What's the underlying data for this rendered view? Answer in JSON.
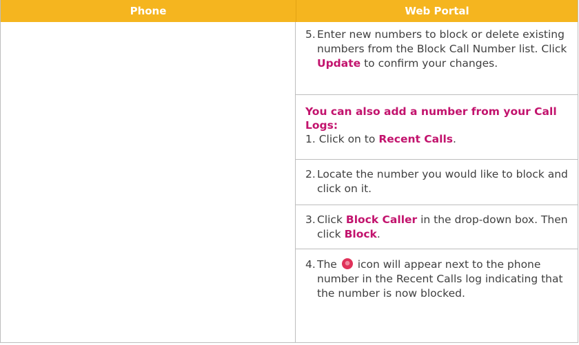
{
  "table": {
    "headers": {
      "phone": "Phone",
      "portal": "Web Portal"
    },
    "colors": {
      "header_bg": "#f5b51f",
      "header_text": "#ffffff",
      "emphasis": "#c2136d",
      "body_text": "#3f3f3f",
      "border": "#bdbdbd"
    },
    "portal_cells": {
      "step5": {
        "num": "5.",
        "text_a": "Enter new numbers to block or delete existing numbers from the Block Call Number list. Click ",
        "em": "Update",
        "text_b": " to confirm your changes."
      },
      "call_logs": {
        "heading": "You can also add a number from your Call Logs:",
        "step1_a": "1. Click on to ",
        "step1_em": "Recent Calls",
        "step1_b": "."
      },
      "step2": {
        "num": "2.",
        "text": "Locate the number you would like to block and click on it."
      },
      "step3": {
        "num": "3.",
        "text_a": "Click ",
        "em1": "Block Caller",
        "text_b": " in the drop-down box. Then click ",
        "em2": "Block",
        "text_c": "."
      },
      "step4": {
        "num": "4.",
        "text_a": "The ",
        "icon": "blocked-caller-icon",
        "text_b": " icon will appear next to the phone number in the Recent Calls log indicating that the number is now blocked."
      }
    }
  }
}
